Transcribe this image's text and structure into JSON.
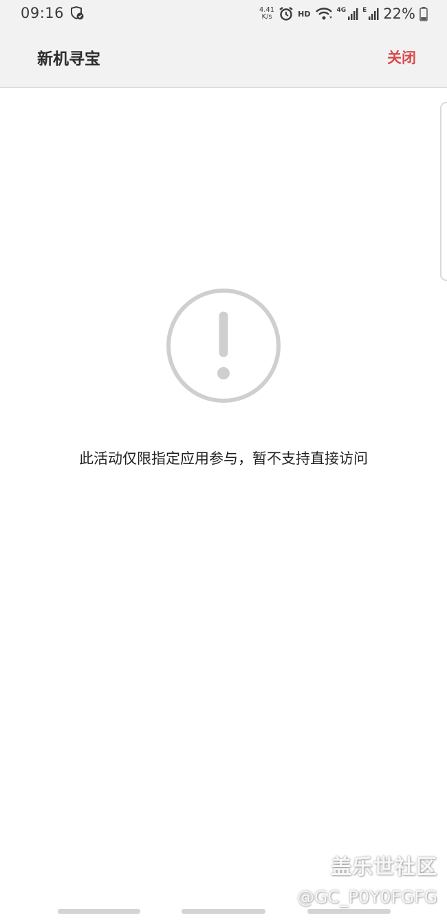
{
  "status_bar": {
    "time": "09:16",
    "net_speed_value": "4.41",
    "net_speed_unit": "K/s",
    "hd": "HD",
    "net_4g": "4G",
    "net_e": "E",
    "battery": "22%"
  },
  "app_bar": {
    "title": "新机寻宝",
    "close_label": "关闭"
  },
  "main": {
    "message": "此活动仅限指定应用参与，暂不支持直接访问"
  },
  "watermark": {
    "brand": "盖乐世社区",
    "user": "@GC_P0Y0FGFG"
  },
  "colors": {
    "accent": "#d94a4a",
    "icon_gray": "#cfcfcf",
    "bar_bg": "#f2f2f2"
  }
}
